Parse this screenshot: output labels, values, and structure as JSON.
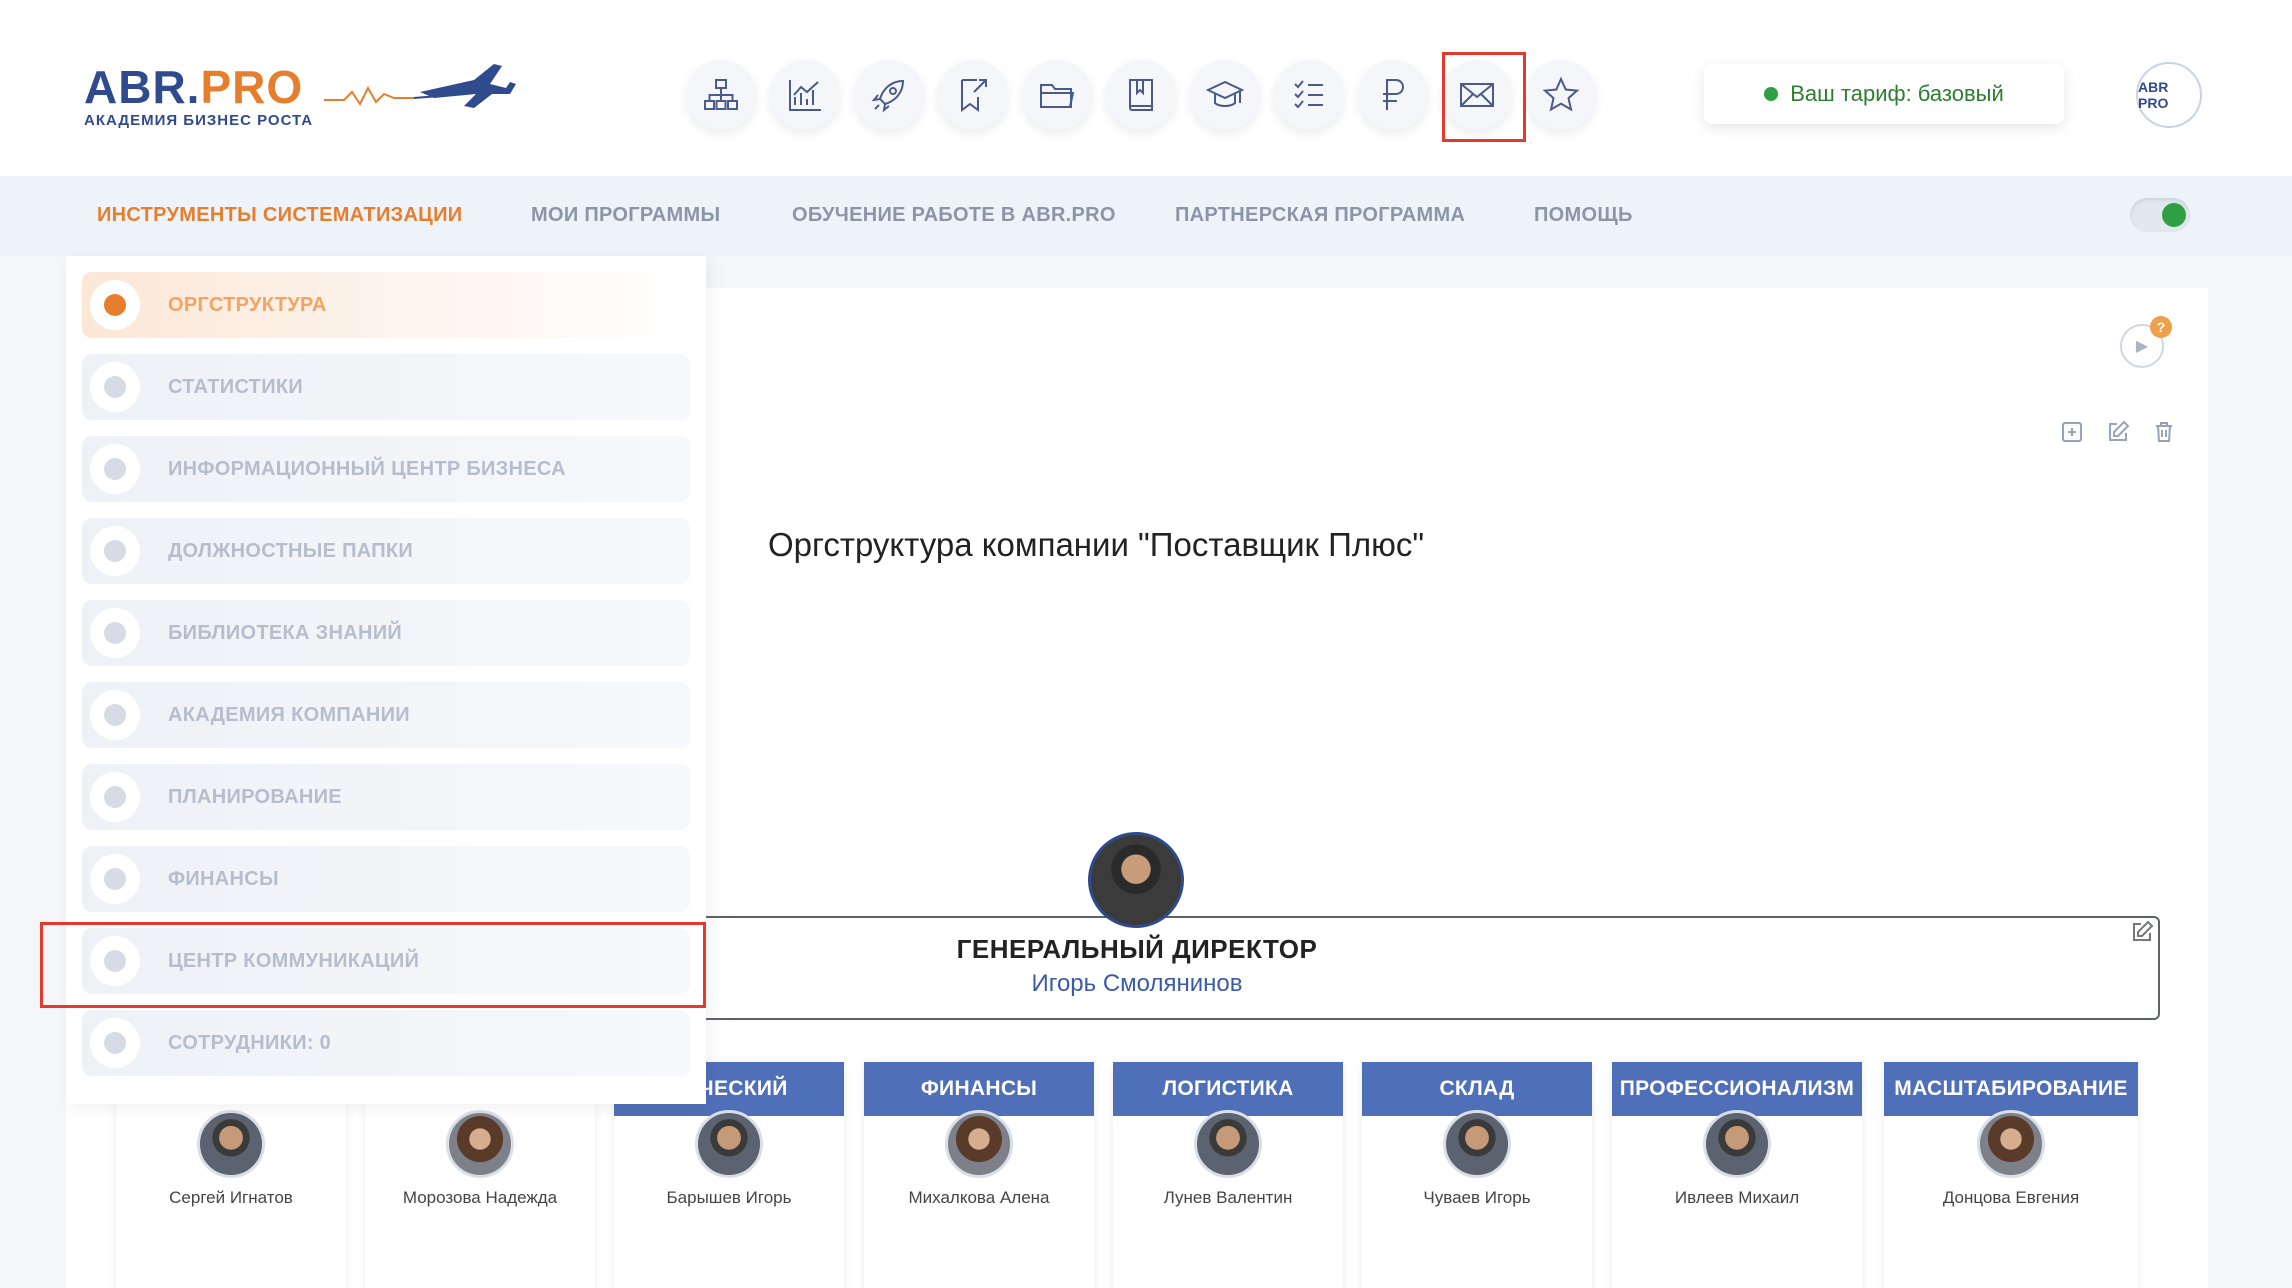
{
  "logo": {
    "main_a": "ABR.",
    "main_b": "PRO",
    "subtitle": "АКАДЕМИЯ БИЗНЕС РОСТА"
  },
  "top_icons": [
    "orgchart-icon",
    "chart-icon",
    "rocket-icon",
    "bookmark-icon",
    "folder-icon",
    "book-icon",
    "graduation-cap-icon",
    "checklist-icon",
    "ruble-icon",
    "mail-icon",
    "star-icon"
  ],
  "tariff": {
    "label": "Ваш тариф: базовый"
  },
  "avatar": {
    "text": "ABR PRO"
  },
  "nav": {
    "items": [
      "ИНСТРУМЕНТЫ СИСТЕМАТИЗАЦИИ",
      "МОИ ПРОГРАММЫ",
      "ОБУЧЕНИЕ РАБОТЕ В ABR.PRO",
      "ПАРТНЕРСКАЯ ПРОГРАММА",
      "ПОМОЩЬ"
    ],
    "active": 0
  },
  "sidebar": {
    "items": [
      {
        "label": "ОРГСТРУКТУРА"
      },
      {
        "label": "СТАТИСТИКИ"
      },
      {
        "label": "ИНФОРМАЦИОННЫЙ ЦЕНТР БИЗНЕСА"
      },
      {
        "label": "ДОЛЖНОСТНЫЕ ПАПКИ"
      },
      {
        "label": "БИБЛИОТЕКА ЗНАНИЙ"
      },
      {
        "label": "АКАДЕМИЯ КОМПАНИИ"
      },
      {
        "label": "ПЛАНИРОВАНИЕ"
      },
      {
        "label": "ФИНАНСЫ"
      },
      {
        "label": "ЦЕНТР КОММУНИКАЦИЙ"
      },
      {
        "label": "СОТРУДНИКИ: 0"
      }
    ]
  },
  "main": {
    "help_badge": "?",
    "title": "Оргструктура компании \"Поставщик Плюс\"",
    "director": {
      "title": "ГЕНЕРАЛЬНЫЙ ДИРЕКТОР",
      "name": "Игорь Смолянинов"
    },
    "departments": [
      {
        "title": "",
        "person": "Сергей Игнатов"
      },
      {
        "title": "",
        "person": "Морозова Надежда"
      },
      {
        "title": "ЕРЧЕСКИЙ",
        "person": "Барышев Игорь"
      },
      {
        "title": "ФИНАНСЫ",
        "person": "Михалкова Алена"
      },
      {
        "title": "ЛОГИСТИКА",
        "person": "Лунев Валентин"
      },
      {
        "title": "СКЛАД",
        "person": "Чуваев Игорь"
      },
      {
        "title": "ПРОФЕССИОНАЛИЗМ",
        "person": "Ивлеев Михаил"
      },
      {
        "title": "МАСШТАБИРОВАНИЕ",
        "person": "Донцова Евгения"
      }
    ]
  },
  "colors": {
    "brand_blue": "#2f4b8e",
    "brand_orange": "#e67e2e",
    "dept_blue": "#4f6fb8",
    "highlight_red": "#e23b2e",
    "status_green": "#2ea043"
  }
}
